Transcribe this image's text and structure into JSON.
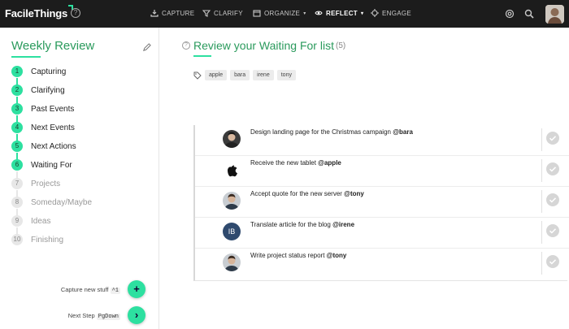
{
  "app": {
    "brand": "FacileThings"
  },
  "nav": {
    "items": [
      {
        "label": "CAPTURE",
        "icon": "capture-icon"
      },
      {
        "label": "CLARIFY",
        "icon": "clarify-icon"
      },
      {
        "label": "ORGANIZE",
        "icon": "organize-icon",
        "dropdown": true
      },
      {
        "label": "REFLECT",
        "icon": "reflect-icon",
        "dropdown": true,
        "active": true
      },
      {
        "label": "ENGAGE",
        "icon": "engage-icon"
      }
    ],
    "right_icons": [
      "target-icon",
      "search-icon",
      "user-avatar"
    ]
  },
  "sidebar": {
    "title": "Weekly Review",
    "steps": [
      {
        "num": "1",
        "label": "Capturing",
        "done": true
      },
      {
        "num": "2",
        "label": "Clarifying",
        "done": true
      },
      {
        "num": "3",
        "label": "Past Events",
        "done": true
      },
      {
        "num": "4",
        "label": "Next Events",
        "done": true
      },
      {
        "num": "5",
        "label": "Next Actions",
        "done": true
      },
      {
        "num": "6",
        "label": "Waiting For",
        "done": true
      },
      {
        "num": "7",
        "label": "Projects",
        "done": false
      },
      {
        "num": "8",
        "label": "Someday/Maybe",
        "done": false
      },
      {
        "num": "9",
        "label": "Ideas",
        "done": false
      },
      {
        "num": "10",
        "label": "Finishing",
        "done": false
      }
    ],
    "capture_label": "Capture new stuff",
    "capture_key": "^1",
    "capture_btn": "+",
    "next_label": "Next Step",
    "next_key": "PgDown",
    "next_btn": "›"
  },
  "main": {
    "title": "Review your Waiting For list",
    "count": "(5)",
    "tags": [
      "apple",
      "bara",
      "irene",
      "tony"
    ],
    "items": [
      {
        "text": "Design landing page for the Christmas campaign ",
        "mention": "@bara",
        "avatar": "photo"
      },
      {
        "text": "Receive the new tablet ",
        "mention": "@apple",
        "avatar": "apple"
      },
      {
        "text": "Accept quote for the new server ",
        "mention": "@tony",
        "avatar": "photo"
      },
      {
        "text": "Translate article for the blog ",
        "mention": "@irene",
        "avatar": "IB"
      },
      {
        "text": "Write project status report ",
        "mention": "@tony",
        "avatar": "photo"
      }
    ]
  },
  "colors": {
    "accent": "#2de0a0",
    "title_green": "#2a9a5c",
    "topbar": "#1c1c1c"
  }
}
